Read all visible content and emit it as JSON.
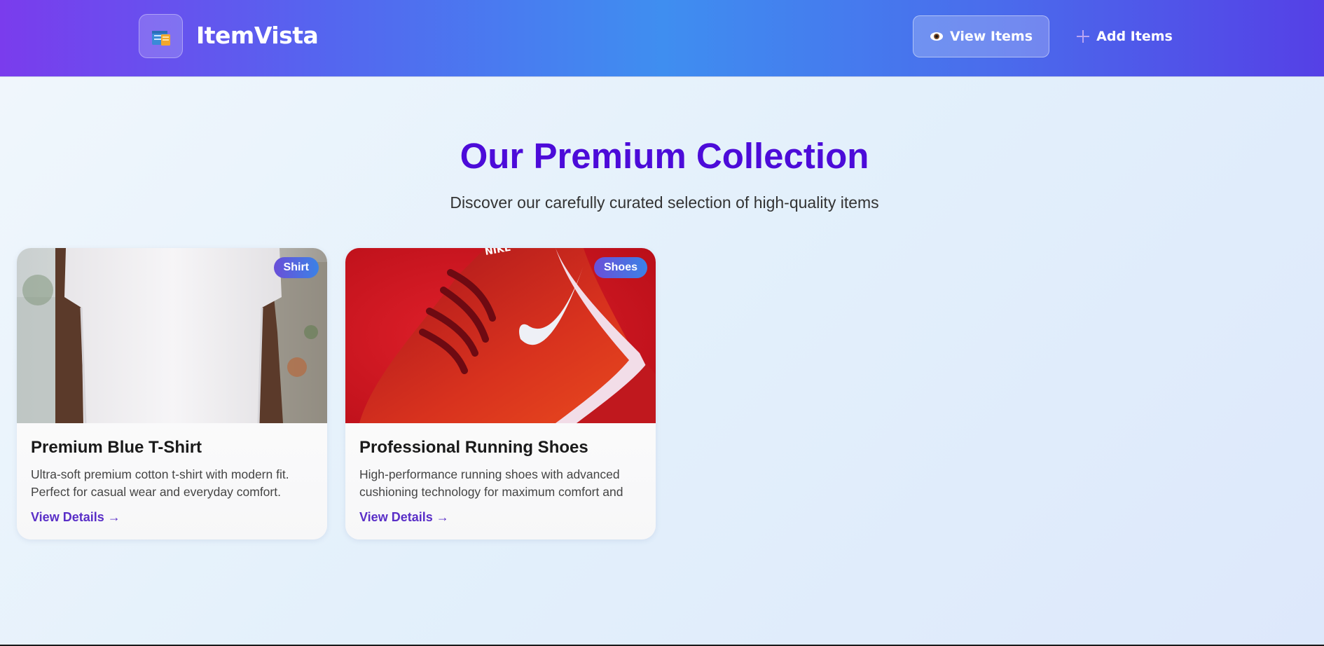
{
  "header": {
    "brand": "ItemVista",
    "nav": [
      {
        "label": "View Items",
        "icon": "eye-icon",
        "active": true
      },
      {
        "label": "Add Items",
        "icon": "plus-icon",
        "active": false
      }
    ]
  },
  "hero": {
    "title": "Our Premium Collection",
    "subtitle": "Discover our carefully curated selection of high-quality items"
  },
  "items": [
    {
      "badge": "Shirt",
      "title": "Premium Blue T-Shirt",
      "description": "Ultra-soft premium cotton t-shirt with modern fit. Perfect for casual wear and everyday comfort.",
      "link": "View Details →"
    },
    {
      "badge": "Shoes",
      "title": "Professional Running Shoes",
      "description": "High-performance running shoes with advanced cushioning technology for maximum comfort and",
      "link": "View Details →"
    }
  ],
  "colors": {
    "accent": "#4c0bd9",
    "link": "#5a2fc7",
    "header_start": "#7a3ced",
    "header_mid": "#3f8ef0",
    "header_end": "#5540e6"
  }
}
